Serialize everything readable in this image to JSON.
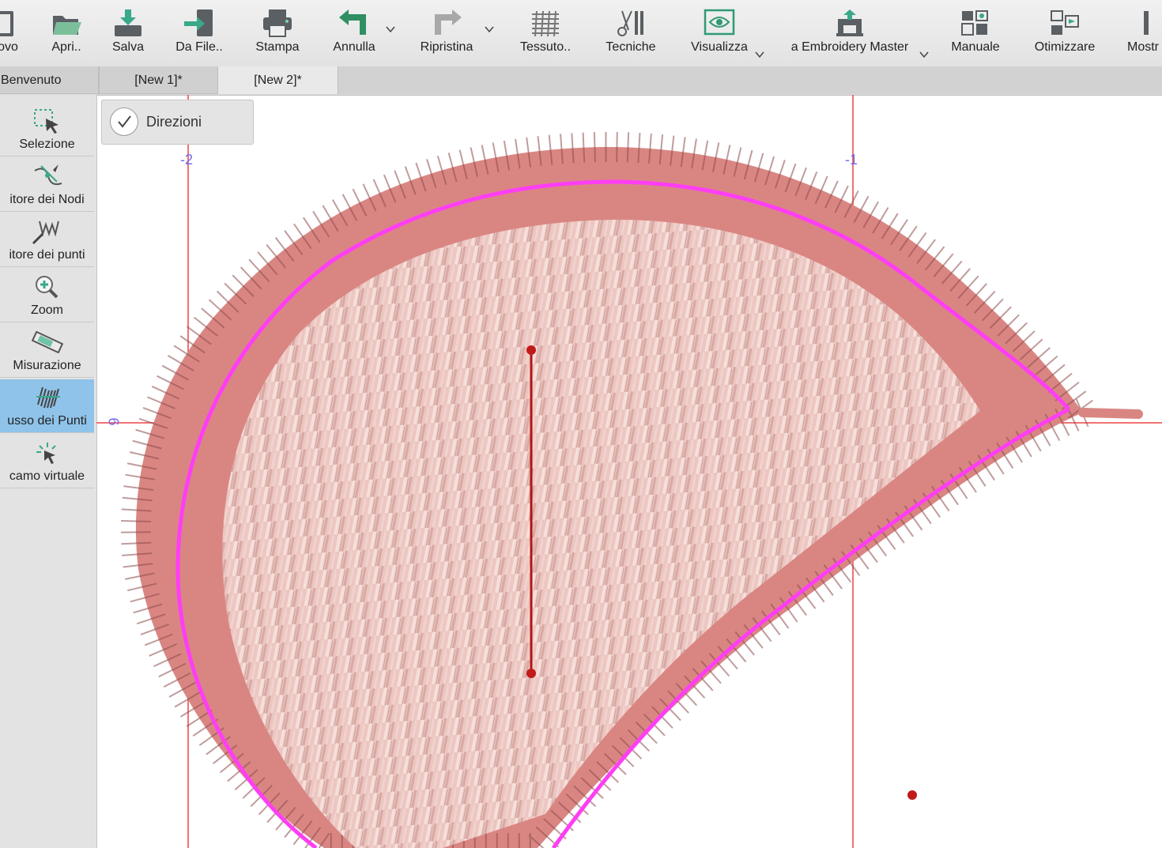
{
  "toolbar": {
    "buttons": [
      {
        "label": "ovo",
        "icon": "new-document-icon"
      },
      {
        "label": "Apri..",
        "icon": "open-folder-icon"
      },
      {
        "label": "Salva",
        "icon": "save-icon"
      },
      {
        "label": "Da File..",
        "icon": "import-file-icon"
      },
      {
        "label": "Stampa",
        "icon": "print-icon"
      },
      {
        "label": "Annulla",
        "icon": "undo-icon"
      },
      {
        "label": "Ripristina",
        "icon": "redo-icon"
      },
      {
        "label": "Tessuto..",
        "icon": "fabric-icon"
      },
      {
        "label": "Tecniche",
        "icon": "techniques-icon"
      },
      {
        "label": "Visualizza",
        "icon": "view-icon"
      },
      {
        "label": "a Embroidery Master",
        "icon": "embroidery-machine-icon"
      },
      {
        "label": "Manuale",
        "icon": "manual-icon"
      },
      {
        "label": "Otimizzare",
        "icon": "optimize-icon"
      },
      {
        "label": "Mostr",
        "icon": "show-icon"
      }
    ]
  },
  "tabs": [
    {
      "label": "Benvenuto"
    },
    {
      "label": "[New 1]*"
    },
    {
      "label": "[New 2]*"
    }
  ],
  "tools": [
    {
      "label": "Selezione",
      "icon": "selection-icon"
    },
    {
      "label": "itore dei Nodi",
      "icon": "node-editor-icon"
    },
    {
      "label": "itore dei punti",
      "icon": "stitch-editor-icon"
    },
    {
      "label": "Zoom",
      "icon": "zoom-icon"
    },
    {
      "label": "Misurazione",
      "icon": "measure-icon"
    },
    {
      "label": "usso dei Punti",
      "icon": "stitch-flow-icon"
    },
    {
      "label": "camo virtuale",
      "icon": "virtual-embroidery-icon"
    }
  ],
  "direzioni": {
    "label": "Direzioni",
    "checked": true
  },
  "rulers": {
    "x_labels": [
      "-2",
      "-1"
    ],
    "y_label": "6"
  },
  "colors": {
    "outline": "#ff3df5",
    "satin_border": "#d98683",
    "fill_stitch": "#e9b8b3",
    "guide_lines": "#ee4444",
    "direction_line": "#b21515",
    "ruler_text": "#6f6cf0",
    "active_tool": "#8fc3e9"
  }
}
